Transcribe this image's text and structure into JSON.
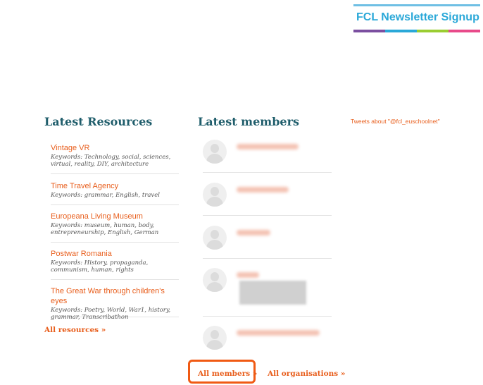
{
  "newsletter": {
    "label": "FCL Newsletter Signup",
    "stripe_colors": [
      "#7b4fa0",
      "#2aa8d8",
      "#9acd32",
      "#e84a8a"
    ]
  },
  "resources": {
    "title": "Latest Resources",
    "items": [
      {
        "title": "Vintage VR",
        "keywords": "Keywords: Technology, social, sciences, virtual, reality, DIY, architecture"
      },
      {
        "title": "Time Travel Agency",
        "keywords": "Keywords: grammar, English, travel"
      },
      {
        "title": "Europeana Living Museum",
        "keywords": "Keywords: museum, human, body, entrepreneurship, English, German"
      },
      {
        "title": "Postwar Romania",
        "keywords": "Keywords: History, propaganda, communism, human, rights"
      },
      {
        "title": "The Great War through children's eyes",
        "keywords": "Keywords: Poetry, World, War1, history, grammar, Transcribathon"
      }
    ],
    "all_link": "All resources »"
  },
  "members": {
    "title": "Latest members",
    "all_link": "All members »",
    "orgs_link": "All organisations »"
  },
  "tweets": {
    "label": "Tweets about \"@fcl_euschoolnet\""
  },
  "colors": {
    "accent": "#e85e1c",
    "heading": "#1f5d6b",
    "highlight": "#f05a14"
  }
}
